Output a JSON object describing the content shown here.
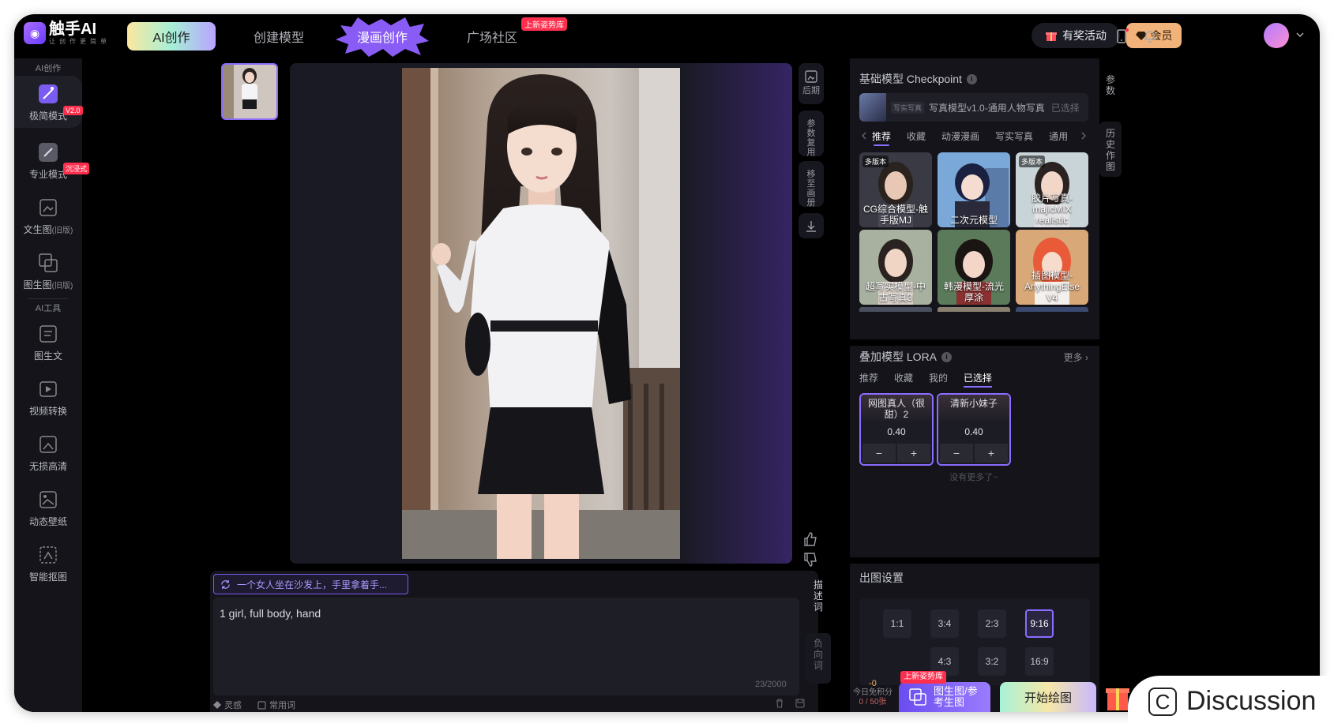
{
  "app": {
    "logo_text": "触手AI",
    "slogan": "让创作更简单"
  },
  "nav": {
    "ai_create": "AI创作",
    "create_model": "创建模型",
    "comic_create": "漫画创作",
    "community": "广场社区",
    "community_badge": "上新姿势库"
  },
  "top_right": {
    "reward": "有奖活动",
    "vip": "会员"
  },
  "sidebar": {
    "section_ai": "AI创作",
    "section_tools": "AI工具",
    "items": [
      {
        "label": "极简模式",
        "tag": "V2.0"
      },
      {
        "label": "专业模式",
        "tag": "沉浸式"
      },
      {
        "label": "文生图",
        "suffix": "(旧版)"
      },
      {
        "label": "图生图",
        "suffix": "(旧版)"
      },
      {
        "label": "图生文"
      },
      {
        "label": "视频转换"
      },
      {
        "label": "无损高清"
      },
      {
        "label": "动态壁纸"
      },
      {
        "label": "智能抠图"
      }
    ]
  },
  "canvas_tools": [
    {
      "label": "后期"
    },
    {
      "label": "参数复用"
    },
    {
      "label": "移至画册"
    }
  ],
  "prompt": {
    "suggestion": "一个女人坐在沙发上，手里拿着手...",
    "text": "1 girl, full body, hand",
    "count": "23/2000",
    "inspiration": "灵感",
    "common_words": "常用词",
    "desc_tab": "描述词",
    "neg_tab": "负向词"
  },
  "right_panel": {
    "checkpoint_title": "基础模型 Checkpoint",
    "selected_tag": "写实写真",
    "selected_name": "写真模型v1.0-通用人物写真",
    "selected_state": "已选择",
    "categories": [
      "推荐",
      "收藏",
      "动漫漫画",
      "写实写真",
      "通用"
    ],
    "models": [
      {
        "name": "CG综合模型-触手版MJ",
        "badge": "多版本"
      },
      {
        "name": "二次元模型",
        "badge": ""
      },
      {
        "name": "胶片写真-majicMIX realistic",
        "badge": "多版本"
      },
      {
        "name": "超写实模型-中古写真3",
        "badge": ""
      },
      {
        "name": "韩漫模型-流光厚涂",
        "badge": ""
      },
      {
        "name": "插图模型-AnythingElse V4",
        "badge": ""
      }
    ],
    "lora_title": "叠加模型 LORA",
    "lora_more": "更多",
    "lora_tabs": [
      "推荐",
      "收藏",
      "我的",
      "已选择"
    ],
    "loras": [
      {
        "name": "网图真人（很甜）2",
        "value": "0.40"
      },
      {
        "name": "清新小妹子",
        "value": "0.40"
      }
    ],
    "lora_empty": "没有更多了~",
    "output_title": "出图设置",
    "ratios": [
      "1:1",
      "3:4",
      "2:3",
      "9:16",
      "4:3",
      "3:2",
      "16:9"
    ],
    "active_ratio": "9:16",
    "side_tabs": [
      "参数",
      "历史作图"
    ]
  },
  "bottom": {
    "credits_value": "-0",
    "credits_label": "今日免积分",
    "credits_count": "0 / 50张",
    "img2img_badge": "上新姿势库",
    "img2img_label": "图生图/参考生图",
    "start": "开始绘图"
  },
  "overlay": {
    "discussion": "Discussion"
  },
  "colors": {
    "accent": "#8a6cff",
    "badge_red": "#ff2e4d",
    "vip_gold": "#f2b37a"
  }
}
